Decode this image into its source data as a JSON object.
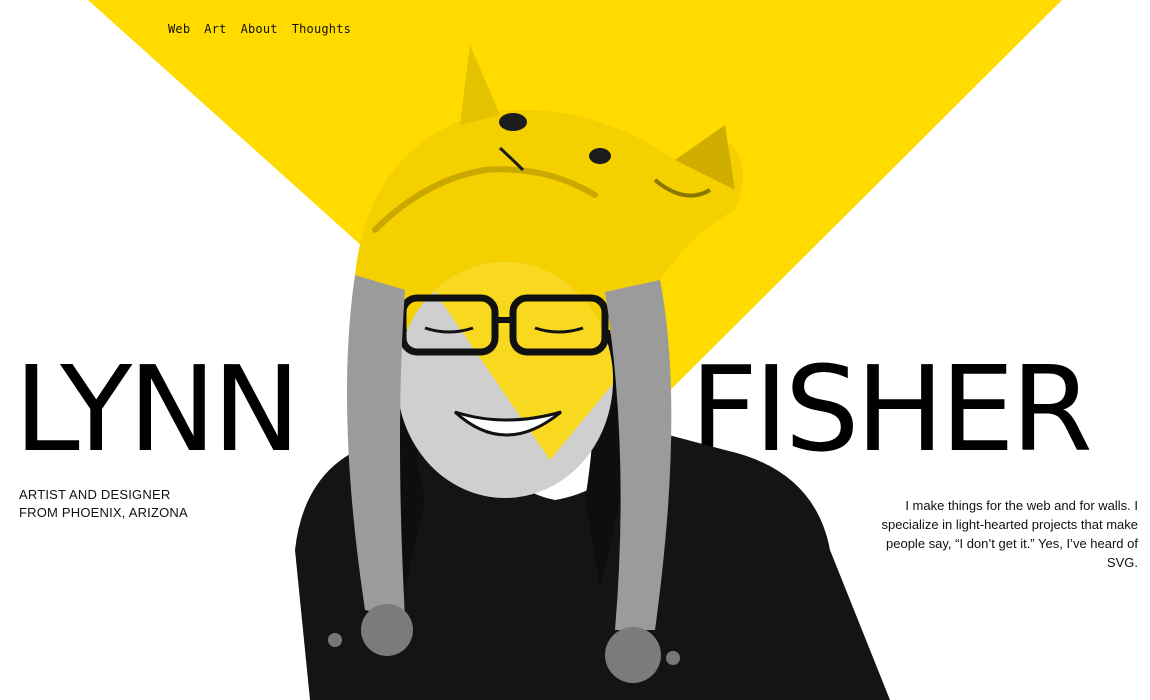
{
  "nav": {
    "items": [
      {
        "label": "Web"
      },
      {
        "label": "Art"
      },
      {
        "label": "About"
      },
      {
        "label": "Thoughts"
      }
    ]
  },
  "hero": {
    "first_name": "LYNN",
    "last_name": "FISHER"
  },
  "tagline": {
    "line1": "ARTIST AND DESIGNER",
    "line2": "FROM PHOENIX, ARIZONA"
  },
  "bio": {
    "text": "I make things for the web and for walls. I specialize in light-hearted projects that make people say, “I don’t get it.” Yes, I’ve heard of SVG."
  },
  "colors": {
    "accent": "#FFDB00",
    "text": "#111111",
    "background": "#FFFFFF"
  }
}
